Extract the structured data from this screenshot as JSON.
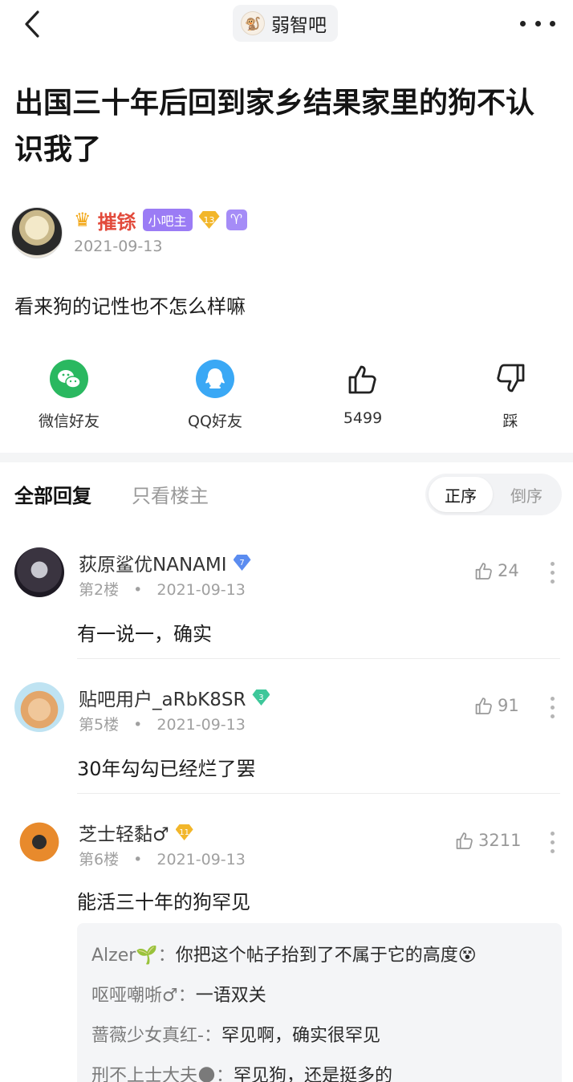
{
  "header": {
    "forum_name": "弱智吧"
  },
  "post": {
    "title": "出国三十年后回到家乡结果家里的狗不认识我了",
    "author": {
      "name": "摧铩",
      "role_badge": "小吧主",
      "level": "13",
      "zodiac": "♈"
    },
    "date": "2021-09-13",
    "body": "看来狗的记性也不怎么样嘛"
  },
  "share": [
    {
      "label": "微信好友",
      "icon": "wechat-icon"
    },
    {
      "label": "QQ好友",
      "icon": "qq-icon"
    },
    {
      "label": "5499",
      "icon": "thumbs-up-icon"
    },
    {
      "label": "踩",
      "icon": "thumbs-down-icon"
    }
  ],
  "reply_tabs": {
    "all": "全部回复",
    "owner_only": "只看楼主",
    "order_asc": "正序",
    "order_desc": "倒序"
  },
  "comments": [
    {
      "name": "荻原鲨优NANAMI",
      "level": "7",
      "floor": "第2楼",
      "date": "2021-09-13",
      "likes": "24",
      "text": "有一说一，确实",
      "gem_color": "#5b8cf0"
    },
    {
      "name": "贴吧用户_aRbK8SR",
      "level": "3",
      "floor": "第5楼",
      "date": "2021-09-13",
      "likes": "91",
      "text": "30年勾勾已经烂了罢",
      "gem_color": "#3ec79a"
    },
    {
      "name": "芝士轻黏♂",
      "level": "11",
      "floor": "第6楼",
      "date": "2021-09-13",
      "likes": "3211",
      "text": "能活三十年的狗罕见",
      "gem_color": "#f2b62a"
    }
  ],
  "sub_replies": [
    {
      "user": "Alzer🌱",
      "text": "你把这个帖子抬到了不属于它的高度😵"
    },
    {
      "user": "呕哑嘲哳♂",
      "text": "一语双关"
    },
    {
      "user": "蔷薇少女真红-",
      "text": "罕见啊，确实很罕见"
    },
    {
      "user": "刑不上士大夫🌑",
      "text": "罕见狗，还是挺多的"
    }
  ],
  "meta_dot": "•",
  "sub_colon": "："
}
